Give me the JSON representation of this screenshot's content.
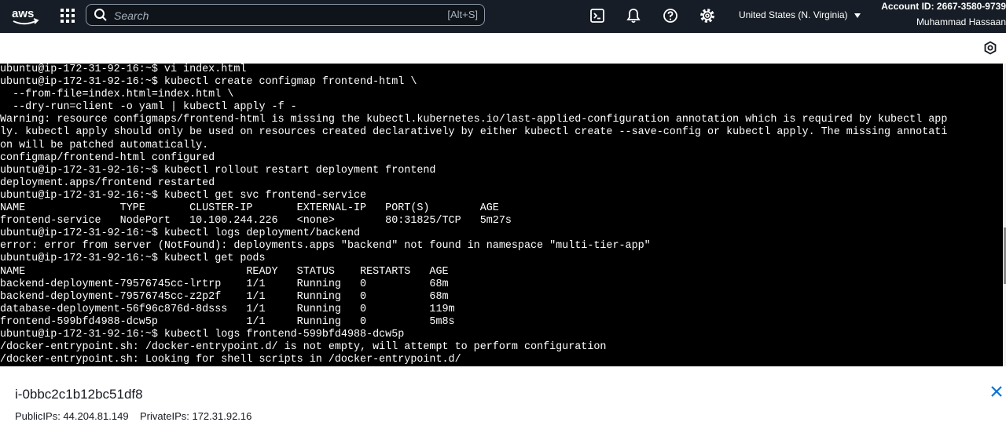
{
  "topbar": {
    "logo_text": "aws",
    "search_placeholder": "Search",
    "search_shortcut": "[Alt+S]",
    "region": "United States (N. Virginia)",
    "account_id": "Account ID: 2667-3580-9739",
    "user_name": "Muhammad Hassaan",
    "icons": [
      "aws-logo-icon",
      "services-grid-icon",
      "search-icon",
      "cloudshell-icon",
      "bell-icon",
      "help-icon",
      "gear-icon",
      "chevron-down-icon"
    ]
  },
  "terminal": {
    "lines": [
      "ubuntu@ip-172-31-92-16:~$ vi index.html",
      "ubuntu@ip-172-31-92-16:~$ kubectl create configmap frontend-html \\",
      "  --from-file=index.html=index.html \\",
      "  --dry-run=client -o yaml | kubectl apply -f -",
      "Warning: resource configmaps/frontend-html is missing the kubectl.kubernetes.io/last-applied-configuration annotation which is required by kubectl app",
      "ly. kubectl apply should only be used on resources created declaratively by either kubectl create --save-config or kubectl apply. The missing annotati",
      "on will be patched automatically.",
      "configmap/frontend-html configured",
      "ubuntu@ip-172-31-92-16:~$ kubectl rollout restart deployment frontend",
      "deployment.apps/frontend restarted",
      "ubuntu@ip-172-31-92-16:~$ kubectl get svc frontend-service",
      "NAME               TYPE       CLUSTER-IP       EXTERNAL-IP   PORT(S)        AGE",
      "frontend-service   NodePort   10.100.244.226   <none>        80:31825/TCP   5m27s",
      "ubuntu@ip-172-31-92-16:~$ kubectl logs deployment/backend",
      "error: error from server (NotFound): deployments.apps \"backend\" not found in namespace \"multi-tier-app\"",
      "ubuntu@ip-172-31-92-16:~$ kubectl get pods",
      "NAME                                   READY   STATUS    RESTARTS   AGE",
      "backend-deployment-79576745cc-lrtrp    1/1     Running   0          68m",
      "backend-deployment-79576745cc-z2p2f    1/1     Running   0          68m",
      "database-deployment-56f96c876d-8dsss   1/1     Running   0          119m",
      "frontend-599bfd4988-dcw5p              1/1     Running   0          5m8s",
      "ubuntu@ip-172-31-92-16:~$ kubectl logs frontend-599bfd4988-dcw5p",
      "/docker-entrypoint.sh: /docker-entrypoint.d/ is not empty, will attempt to perform configuration",
      "/docker-entrypoint.sh: Looking for shell scripts in /docker-entrypoint.d/"
    ]
  },
  "instance": {
    "id": "i-0bbc2c1b12bc51df8",
    "ips": "PublicIPs: 44.204.81.149    PrivateIPs: 172.31.92.16"
  },
  "colors": {
    "topbar_bg": "#161d26",
    "terminal_bg": "#000000",
    "terminal_fg": "#ffffff",
    "close_blue": "#0972d3"
  }
}
